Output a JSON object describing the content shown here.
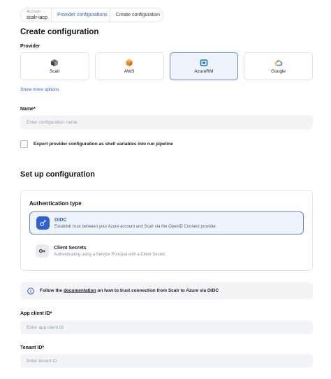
{
  "breadcrumb": {
    "account_caption": "Account",
    "account_value": "scalr-iacp",
    "link": "Provider configurations",
    "current": "Create configuration"
  },
  "page_title": "Create configuration",
  "provider_section": {
    "label": "Provider",
    "options": [
      {
        "name": "Scalr",
        "icon": "scalr-icon",
        "selected": false
      },
      {
        "name": "AWS",
        "icon": "aws-icon",
        "selected": false
      },
      {
        "name": "AzureRM",
        "icon": "azure-icon",
        "selected": true
      },
      {
        "name": "Google",
        "icon": "google-cloud-icon",
        "selected": false
      }
    ],
    "more_link": "Show more options"
  },
  "name_field": {
    "label": "Name*",
    "placeholder": "Enter configuration name",
    "value": ""
  },
  "export_checkbox": {
    "label": "Export provider configuration as shell variables into run pipeline",
    "checked": false
  },
  "setup": {
    "title": "Set up configuration",
    "auth_type_label": "Authentication type",
    "options": [
      {
        "name": "OIDC",
        "description": "Establish trust between your Azure account and Scalr via the OpenID Connect provider.",
        "icon": "oidc-icon",
        "selected": true
      },
      {
        "name": "Client Secrets",
        "description": "Authenticating using a Service Principal with a Client Secret.",
        "icon": "key-icon",
        "selected": false
      }
    ]
  },
  "info": {
    "prefix": "Follow the ",
    "link": "documentation",
    "suffix": " on how to trust connection from Scalr to Azure via OIDC"
  },
  "app_client_field": {
    "label": "App client ID*",
    "placeholder": "Enter app client ID",
    "value": ""
  },
  "tenant_field": {
    "label": "Tenant ID*",
    "placeholder": "Enter tenant ID",
    "value": ""
  },
  "colors": {
    "accent": "#2f61d6",
    "selected_bg": "#eef3fd",
    "selected_border": "#5a86e6",
    "aws_orange": "#f28b1e",
    "azure_blue": "#0a7bd6"
  }
}
